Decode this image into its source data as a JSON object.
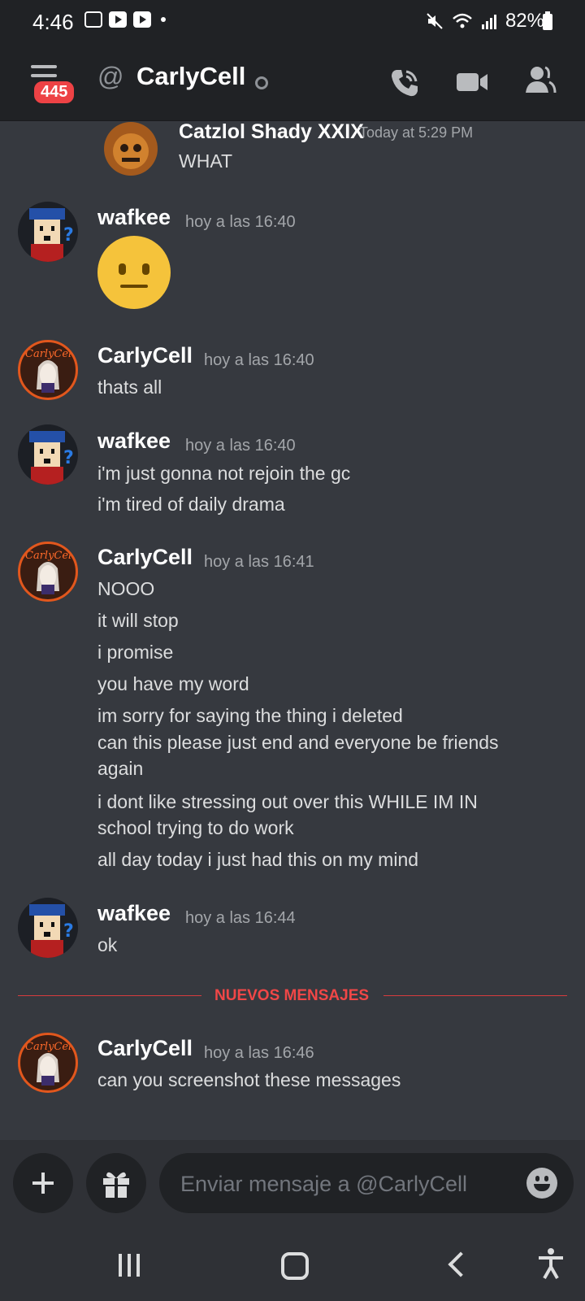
{
  "status_bar": {
    "time": "4:46",
    "battery": "82%"
  },
  "header": {
    "unread_badge": "445",
    "at_symbol": "@",
    "title": "CarlyCell"
  },
  "messages": [
    {
      "author": "Catzlol Shady XXIX",
      "timestamp": "Today at 5:29 PM",
      "lines": [
        "WHAT"
      ]
    },
    {
      "author": "wafkee",
      "timestamp": "hoy a las 16:40",
      "emoji": "neutral-face"
    },
    {
      "author": "CarlyCell",
      "timestamp": "hoy a las 16:40",
      "lines": [
        "thats all"
      ]
    },
    {
      "author": "wafkee",
      "timestamp": "hoy a las 16:40",
      "lines": [
        "i'm just gonna not rejoin the gc",
        "i'm tired of daily drama"
      ]
    },
    {
      "author": "CarlyCell",
      "timestamp": "hoy a las 16:41",
      "lines": [
        "NOOO",
        "it will stop",
        "i promise",
        "you have my word",
        "im sorry for saying the thing i deleted",
        "can this please just end and everyone be friends again",
        "i dont like stressing out over this WHILE IM IN school trying to do work",
        "all day today i just had this on my mind"
      ]
    },
    {
      "author": "wafkee",
      "timestamp": "hoy a las 16:44",
      "lines": [
        "ok"
      ]
    },
    {
      "author": "CarlyCell",
      "timestamp": "hoy a las 16:46",
      "lines": [
        "can you screenshot these messages"
      ]
    }
  ],
  "new_messages_divider": "NUEVOS MENSAJES",
  "composer": {
    "placeholder": "Enviar mensaje a @CarlyCell"
  },
  "colors": {
    "background": "#36393f",
    "header": "#202225",
    "accent_red": "#ed4245",
    "divider_red": "#f04747"
  }
}
